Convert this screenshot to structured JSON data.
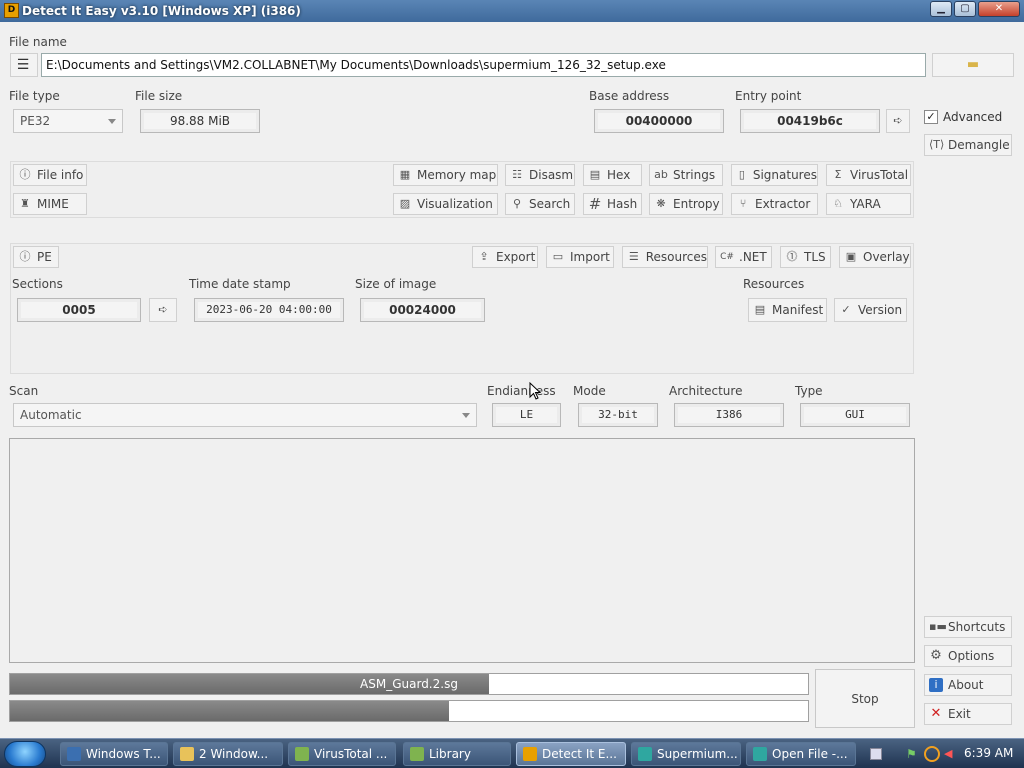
{
  "window": {
    "title": "Detect It Easy v3.10 [Windows XP] (i386)",
    "icon_text": "D",
    "caption_buttons": [
      "minimize-icon",
      "maximize-icon",
      "close-icon"
    ]
  },
  "file": {
    "label": "File name",
    "path": "E:\\Documents and Settings\\VM2.COLLABNET\\My Documents\\Downloads\\supermium_126_32_setup.exe"
  },
  "info": {
    "file_type_label": "File type",
    "file_type": "PE32",
    "file_size_label": "File size",
    "file_size": "98.88 MiB",
    "base_address_label": "Base address",
    "base_address": "00400000",
    "entry_point_label": "Entry point",
    "entry_point": "00419b6c"
  },
  "side": {
    "advanced_label": "Advanced",
    "advanced_checked": "✓",
    "demangle_label": "Demangle",
    "shortcuts_label": "Shortcuts",
    "options_label": "Options",
    "about_label": "About",
    "exit_label": "Exit"
  },
  "tools": {
    "file_info": "File info",
    "mime": "MIME",
    "memory_map": "Memory map",
    "disasm": "Disasm",
    "hex": "Hex",
    "strings": "Strings",
    "signatures": "Signatures",
    "virustotal": "VirusTotal",
    "visualization": "Visualization",
    "search": "Search",
    "hash": "Hash",
    "entropy": "Entropy",
    "extractor": "Extractor",
    "yara": "YARA"
  },
  "pe": {
    "pe_label": "PE",
    "export": "Export",
    "import": "Import",
    "resources": "Resources",
    "net": ".NET",
    "tls": "TLS",
    "overlay": "Overlay",
    "sections_label": "Sections",
    "sections": "0005",
    "timestamp_label": "Time date stamp",
    "timestamp": "2023-06-20 04:00:00",
    "size_of_image_label": "Size of image",
    "size_of_image": "00024000",
    "resources_label": "Resources",
    "manifest": "Manifest",
    "version": "Version"
  },
  "scan": {
    "label": "Scan",
    "mode_value": "Automatic",
    "endianness_label": "Endianness",
    "endianness": "LE",
    "mode_label": "Mode",
    "mode": "32-bit",
    "architecture_label": "Architecture",
    "architecture": "I386",
    "type_label": "Type",
    "type": "GUI"
  },
  "progress": {
    "bar1_text": "ASM_Guard.2.sg",
    "bar1_fraction": 0.6,
    "bar2_fraction": 0.55,
    "stop_label": "Stop"
  },
  "taskbar": {
    "items": [
      {
        "label": "Windows T...",
        "color": "#3b6fb0"
      },
      {
        "label": "2 Window...",
        "color": "#e8c25a"
      },
      {
        "label": "VirusTotal ...",
        "color": "#7fb34f"
      },
      {
        "label": "Library",
        "color": "#7fb34f"
      },
      {
        "label": "Detect It E...",
        "color": "#e8a000"
      },
      {
        "label": "Supermium...",
        "color": "#2fa7a0"
      },
      {
        "label": "Open File -...",
        "color": "#2fa7a0"
      }
    ],
    "clock": "6:39 AM"
  }
}
